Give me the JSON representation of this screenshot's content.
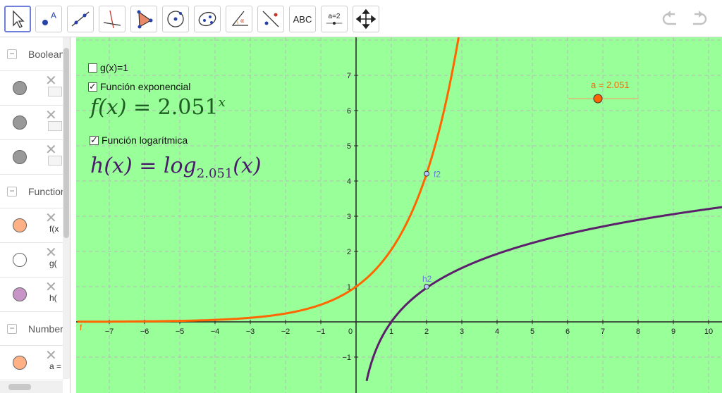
{
  "toolbar": {
    "tools": [
      {
        "name": "move-tool",
        "label": ""
      },
      {
        "name": "point-tool",
        "label": ""
      },
      {
        "name": "line-tool",
        "label": ""
      },
      {
        "name": "perpendicular-line-tool",
        "label": ""
      },
      {
        "name": "polygon-tool",
        "label": ""
      },
      {
        "name": "circle-center-point-tool",
        "label": ""
      },
      {
        "name": "ellipse-tool",
        "label": ""
      },
      {
        "name": "angle-tool",
        "label": ""
      },
      {
        "name": "reflect-tool",
        "label": ""
      },
      {
        "name": "text-tool",
        "label": "ABC"
      },
      {
        "name": "slider-tool",
        "label": "a=2"
      },
      {
        "name": "move-graphics-view-tool",
        "label": ""
      }
    ]
  },
  "algebra": {
    "categories": [
      {
        "label": "Boolean Value"
      },
      {
        "label": "Function"
      },
      {
        "label": "Number"
      }
    ],
    "rows": [
      {
        "color": "#999999",
        "expr": ""
      },
      {
        "color": "#999999",
        "expr": ""
      },
      {
        "color": "#999999",
        "expr": ""
      },
      {
        "color": "#ffb085",
        "expr": "f(x"
      },
      {
        "color": "#ffffff",
        "expr": "g("
      },
      {
        "color": "#c895c8",
        "expr": "h("
      },
      {
        "color": "#ffb085",
        "expr": "a ="
      }
    ]
  },
  "graphics": {
    "checkboxes": [
      {
        "label": "g(x)=1",
        "checked": false
      },
      {
        "label": "Función exponencial",
        "checked": true
      },
      {
        "label": "Función logarítmica",
        "checked": true
      }
    ],
    "f_formula": {
      "lhs": "f(x)",
      "eq": "=",
      "base": "2.051",
      "exp": "x"
    },
    "h_formula": {
      "lhs": "h(x)",
      "eq": "=",
      "fn": "log",
      "sub": "2.051",
      "arg": "(x)"
    },
    "slider": {
      "label": "a = 2.051",
      "value": 2.051,
      "color": "#ff6600"
    },
    "point_labels": {
      "f2": "f2",
      "h2": "h2",
      "f": "f"
    },
    "colors": {
      "background": "#99ff99",
      "exp_curve": "#ff6600",
      "log_curve": "#5c1f6b",
      "point": "#6a7bd8"
    }
  },
  "chart_data": {
    "type": "line",
    "xlim": [
      -7.9,
      10.3
    ],
    "ylim": [
      -1.8,
      8.2
    ],
    "x_ticks": [
      -7,
      -6,
      -5,
      -4,
      -3,
      -2,
      -1,
      0,
      1,
      2,
      3,
      4,
      5,
      6,
      7,
      8,
      9,
      10
    ],
    "y_ticks": [
      -1,
      1,
      2,
      3,
      4,
      5,
      6,
      7
    ],
    "tick_labels_x": [
      "−7",
      "−6",
      "−5",
      "−4",
      "−3",
      "−2",
      "−1",
      "0",
      "1",
      "2",
      "3",
      "4",
      "5",
      "6",
      "7",
      "8",
      "9",
      "10"
    ],
    "tick_labels_y": [
      "−1",
      "1",
      "2",
      "3",
      "4",
      "5",
      "6",
      "7"
    ],
    "grid": true,
    "series": [
      {
        "name": "f",
        "base": 2.051,
        "kind": "exponential"
      },
      {
        "name": "h",
        "base": 2.051,
        "kind": "logarithmic"
      }
    ],
    "points": [
      {
        "name": "f2",
        "x": 2,
        "y": 4.2066
      },
      {
        "name": "h2",
        "x": 2,
        "y": 1
      }
    ]
  }
}
